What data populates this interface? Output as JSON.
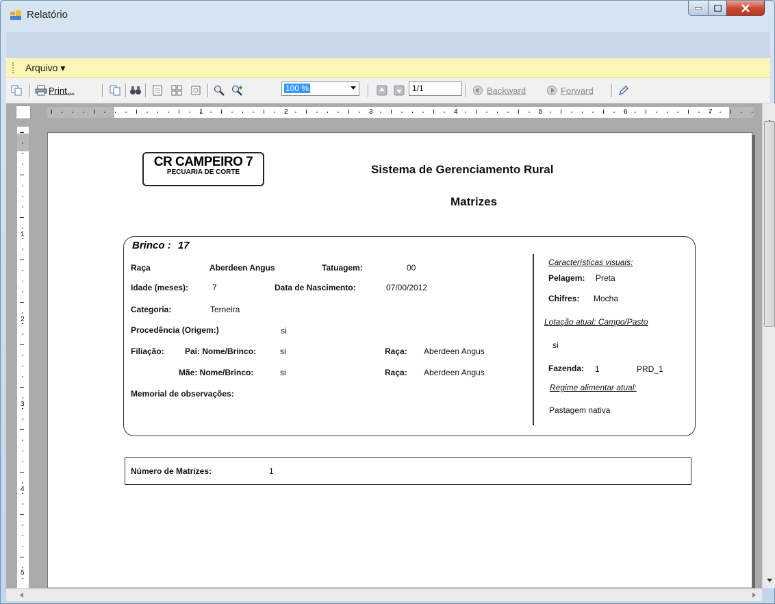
{
  "window": {
    "title": "Relatório"
  },
  "menu": {
    "arquivo": "Arquivo ▾"
  },
  "toolbar": {
    "print_label": "Print...",
    "zoom_value": "100 %",
    "page_value": "1/1",
    "backward_label": "Backward",
    "forward_label": "Forward"
  },
  "ruler": {
    "h_numbers": [
      "1",
      "2",
      "3",
      "4",
      "5",
      "6",
      "7"
    ],
    "v_numbers": [
      "1",
      "2",
      "3",
      "4",
      "5"
    ]
  },
  "report": {
    "logo_line1": "CR CAMPEIRO 7",
    "logo_line2": "PECUARIA DE CORTE",
    "title": "Sistema de Gerenciamento Rural",
    "subtitle": "Matrizes",
    "brinco_label": "Brinco :",
    "brinco_value": "17",
    "raca_label": "Raça",
    "raca_value": "Aberdeen Angus",
    "tatuagem_label": "Tatuagem:",
    "tatuagem_value": "00",
    "idade_label": "Idade (meses):",
    "idade_value": "7",
    "nascimento_label": "Data de Nascimento:",
    "nascimento_value": "07/00/2012",
    "categoria_label": "Categoria:",
    "categoria_value": "Terneira",
    "procedencia_label": "Procedência (Origem:)",
    "procedencia_value": "si",
    "filiacao_label": "Filiação:",
    "pai_label": "Pai: Nome/Brinco:",
    "pai_value": "si",
    "pai_raca_label": "Raça:",
    "pai_raca_value": "Aberdeen Angus",
    "mae_label": "Mãe: Nome/Brinco:",
    "mae_value": "si",
    "mae_raca_label": "Raça:",
    "mae_raca_value": "Aberdeen Angus",
    "memorial_label": "Memorial de observações:",
    "caracteristicas_label": "Características visuais:",
    "pelagem_label": "Pelagem:",
    "pelagem_value": "Preta",
    "chifres_label": "Chifres:",
    "chifres_value": "Mocha",
    "lotacao_label": "Lotação atual: Campo/Pasto",
    "lotacao_value": "si",
    "fazenda_label": "Fazenda:",
    "fazenda_value": "1",
    "fazenda_code": "PRD_1",
    "regime_label": "Regime alimentar atual:",
    "regime_value": "Pastagem nativa",
    "numero_label": "Número de Matrizes:",
    "numero_value": "1"
  },
  "colors": {
    "menubar_bg": "#fbf6b5",
    "zoom_highlight": "#3399ff",
    "close_button": "#c8452f"
  }
}
